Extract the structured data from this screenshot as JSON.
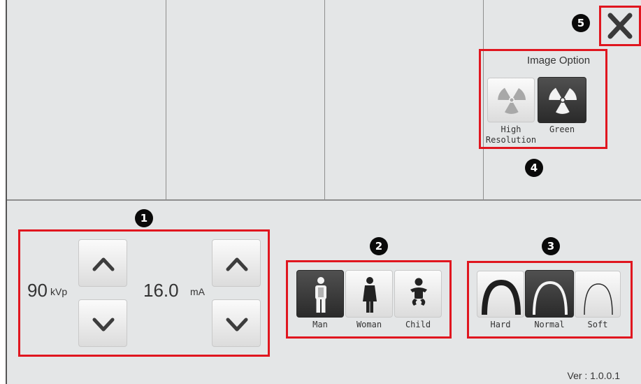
{
  "image_option": {
    "title": "Image Option",
    "buttons": [
      {
        "label_line1": "High",
        "label_line2": "Resolution",
        "selected": false
      },
      {
        "label_line1": "Green",
        "label_line2": "",
        "selected": true
      }
    ]
  },
  "exposure": {
    "kvp_value": "90",
    "kvp_unit": "kVp",
    "ma_value": "16.0",
    "ma_unit": "mA"
  },
  "patient": {
    "buttons": [
      {
        "label": "Man",
        "selected": true
      },
      {
        "label": "Woman",
        "selected": false
      },
      {
        "label": "Child",
        "selected": false
      }
    ]
  },
  "filter": {
    "buttons": [
      {
        "label": "Hard",
        "selected": false
      },
      {
        "label": "Normal",
        "selected": true
      },
      {
        "label": "Soft",
        "selected": false
      }
    ]
  },
  "badges": [
    "1",
    "2",
    "3",
    "4",
    "5"
  ],
  "version": "Ver : 1.0.0.1",
  "colors": {
    "highlight": "#e0161f",
    "selected_button": "#3a3a3a",
    "background": "#e4e6e7"
  }
}
